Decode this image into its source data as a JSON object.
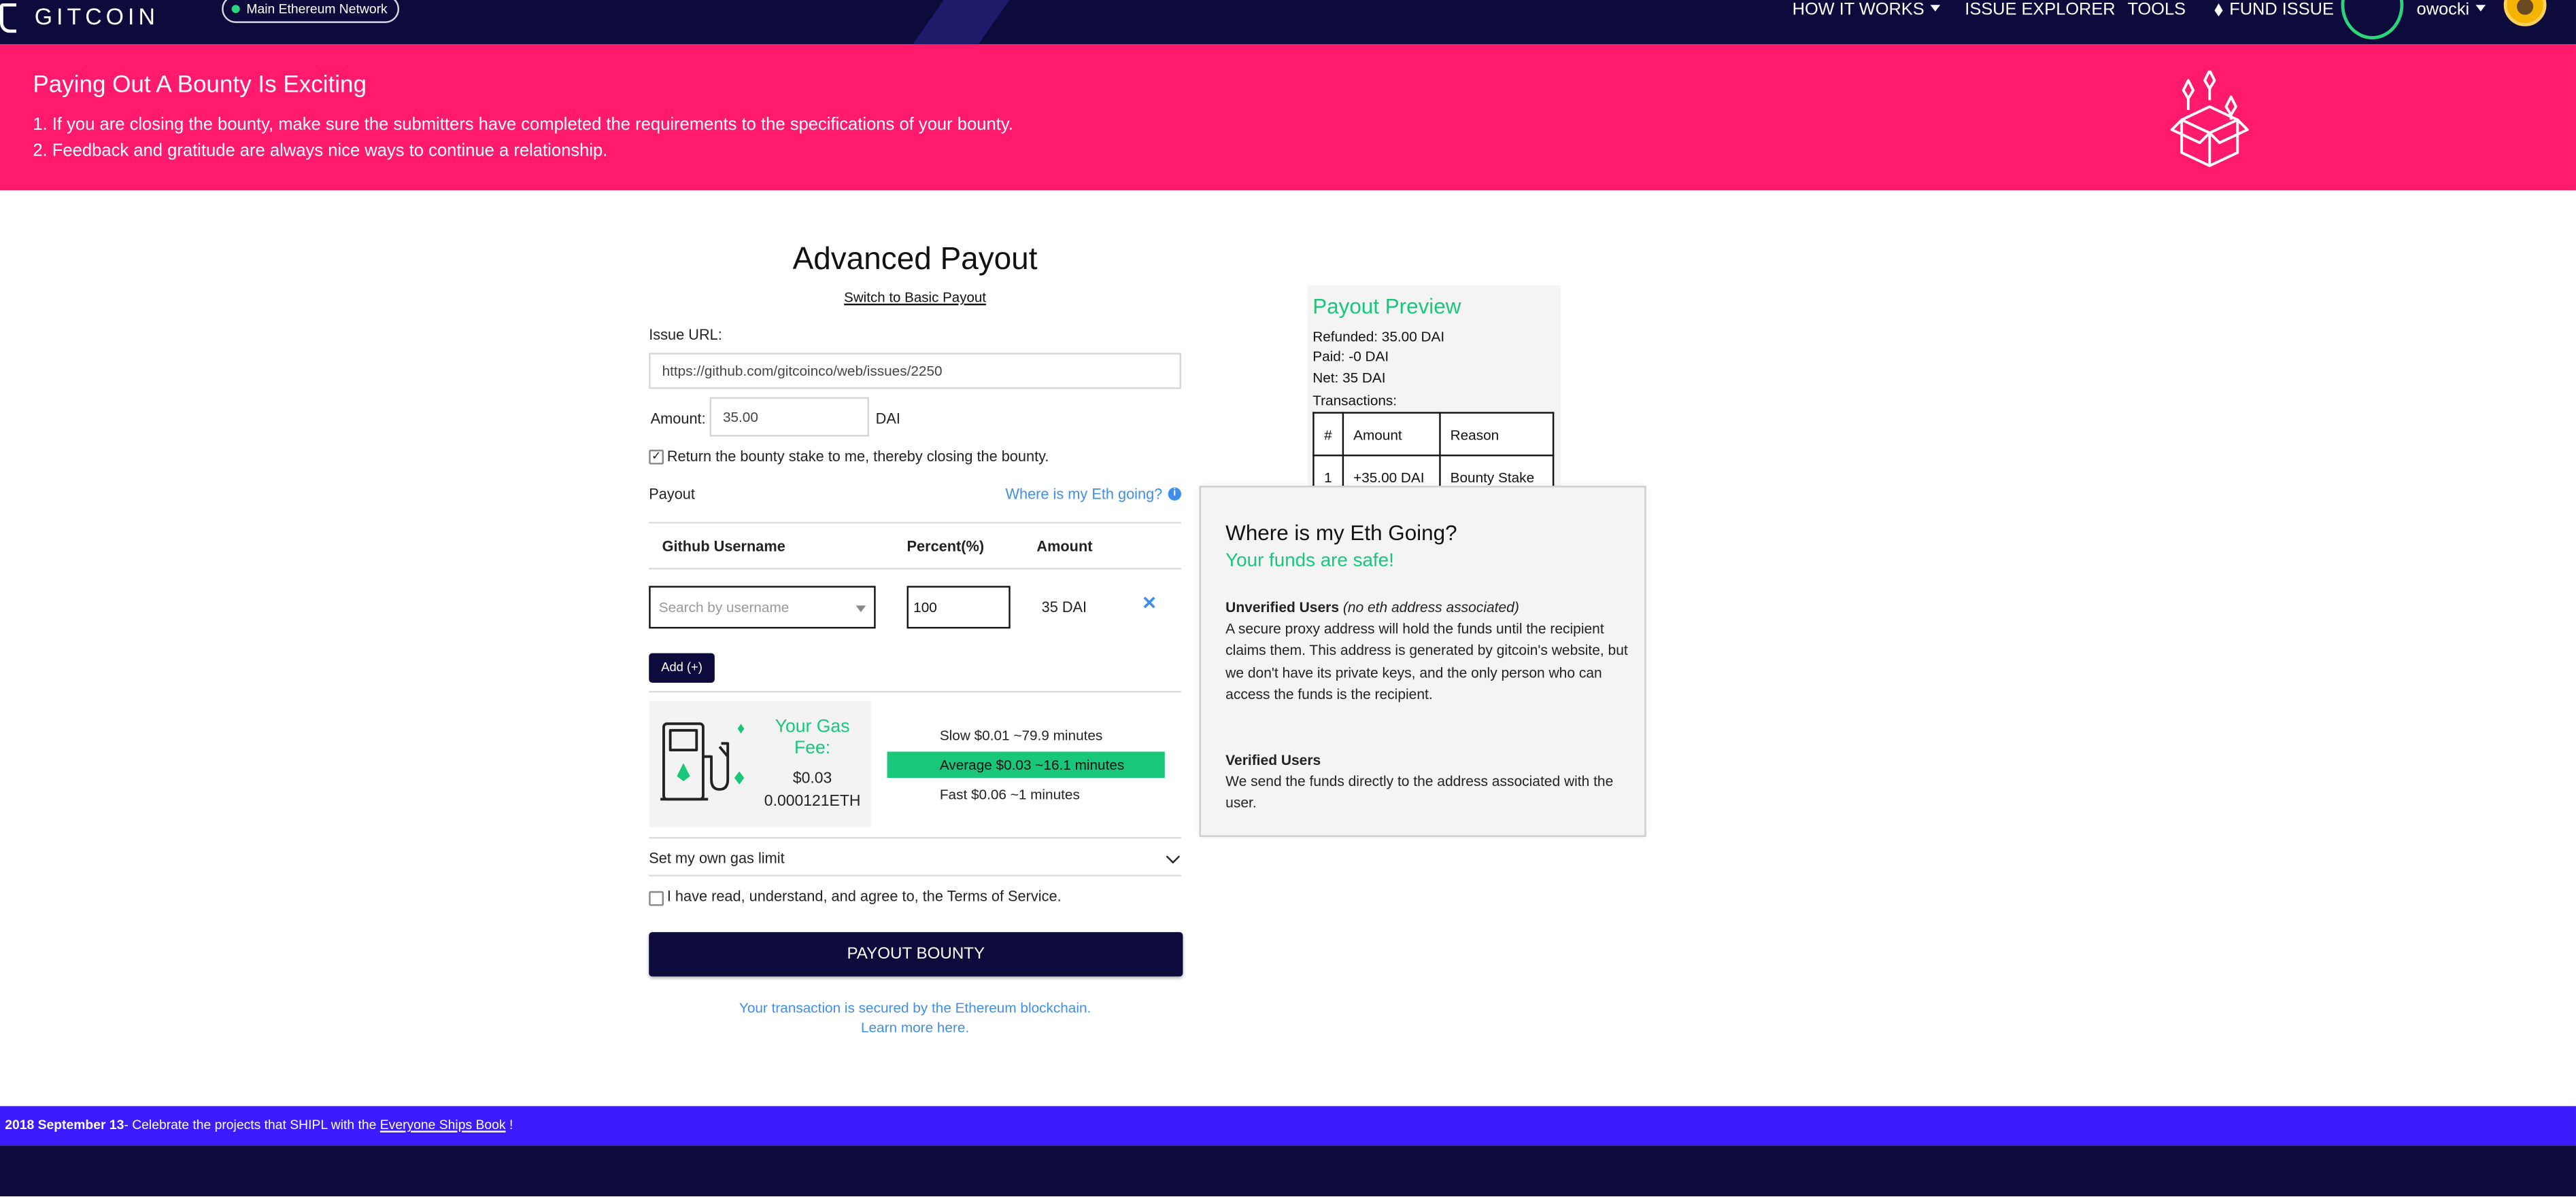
{
  "nav": {
    "logo": "GITCOIN",
    "network": "Main Ethereum Network",
    "menu": {
      "how_it_works": "HOW IT WORKS",
      "issue_explorer": "ISSUE EXPLORER",
      "tools": "TOOLS",
      "fund_issue": "FUND ISSUE",
      "user": "owocki"
    }
  },
  "banner": {
    "title": "Paying Out A Bounty Is Exciting",
    "tips": [
      "1. If you are closing the bounty, make sure the submitters have completed the requirements to the specifications of your bounty.",
      "2. Feedback and gratitude are always nice ways to continue a relationship."
    ]
  },
  "form": {
    "title": "Advanced Payout",
    "switch_link": "Switch to Basic Payout",
    "issue_url_label": "Issue URL:",
    "issue_url_value": "https://github.com/gitcoinco/web/issues/2250",
    "amount_label": "Amount:",
    "amount_value": "35.00",
    "amount_unit": "DAI",
    "return_stake_label": "Return the bounty stake to me, thereby closing the bounty.",
    "return_stake_checked": true,
    "payout_label": "Payout",
    "eth_going_link": "Where is my Eth going?",
    "table": {
      "headers": [
        "Github Username",
        "Percent(%)",
        "Amount"
      ],
      "rows": [
        {
          "username_placeholder": "Search by username",
          "percent": "100",
          "amount": "35 DAI"
        }
      ]
    },
    "add_button": "Add (+)",
    "gas": {
      "title": "Your Gas Fee:",
      "usd": "$0.03",
      "eth": "0.000121ETH",
      "options": [
        {
          "label": "Slow $0.01 ~79.9 minutes",
          "selected": false
        },
        {
          "label": "Average $0.03 ~16.1 minutes",
          "selected": true
        },
        {
          "label": "Fast $0.06 ~1 minutes",
          "selected": false
        }
      ]
    },
    "gas_limit_toggle": "Set my own gas limit",
    "tos_prefix": "I have read, understand, and agree to, the",
    "tos_link": "Terms of Service",
    "tos_suffix": ".",
    "submit": "PAYOUT BOUNTY",
    "secured_line1": "Your transaction is secured by the Ethereum blockchain.",
    "secured_line2": "Learn more here."
  },
  "preview": {
    "title": "Payout Preview",
    "refunded": "Refunded: 35.00 DAI",
    "paid": "Paid: -0 DAI",
    "net": "Net: 35 DAI",
    "transactions_label": "Transactions:",
    "table": {
      "headers": [
        "#",
        "Amount",
        "Reason"
      ],
      "rows": [
        [
          "1",
          "+35.00 DAI",
          "Bounty Stake"
        ]
      ]
    }
  },
  "popover": {
    "title": "Where is my Eth Going?",
    "subtitle": "Your funds are safe!",
    "unverified_heading": "Unverified Users",
    "unverified_note": "(no eth address associated)",
    "unverified_body": "A secure proxy address will hold the funds until the recipient claims them. This address is generated by gitcoin's website, but we don't have its private keys, and the only person who can access the funds is the recipient.",
    "verified_heading": "Verified Users",
    "verified_body": "We send the funds directly to the address associated with the user."
  },
  "announcement": {
    "date": "2018 September 13",
    "text": "- Celebrate the projects that SHIPL with the",
    "link": "Everyone Ships Book",
    "suffix": "!"
  },
  "colors": {
    "nav_bg": "#0d0b3c",
    "banner_bg": "#ff1a6b",
    "accent_green": "#18c77a",
    "link_blue": "#3e8eea",
    "announce_bg": "#3b1cff"
  }
}
